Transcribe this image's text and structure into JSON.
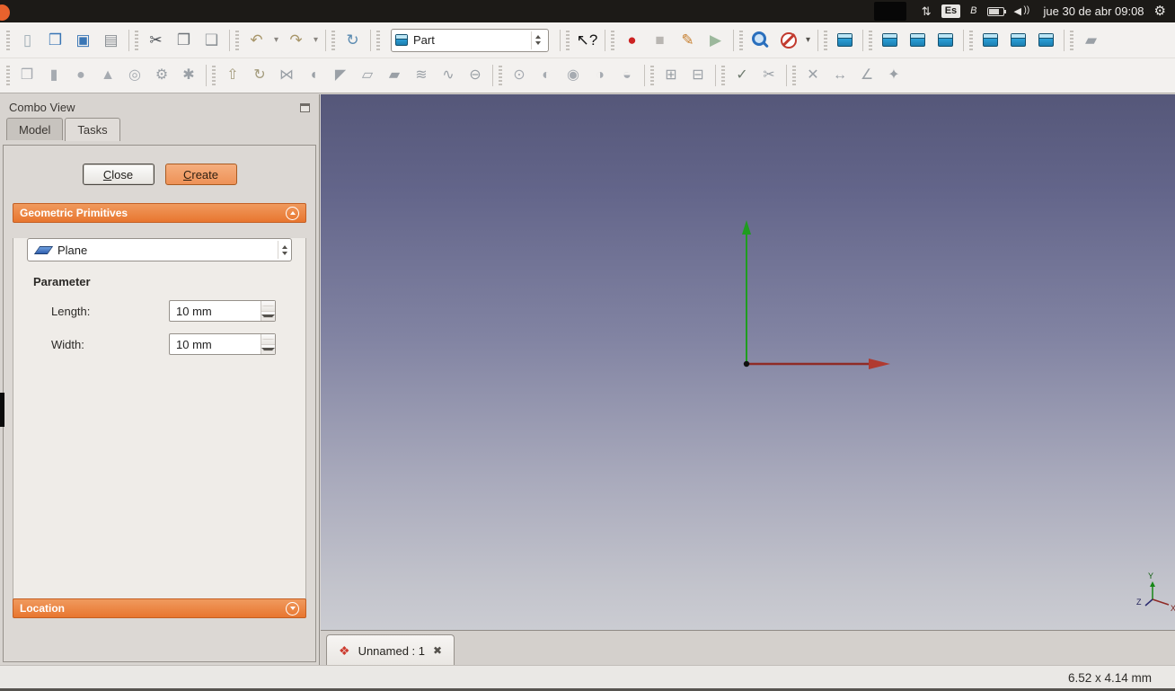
{
  "system_bar": {
    "keyboard_layout": "Es",
    "clock": "jue 30 de abr 09:08"
  },
  "main_toolbar": {
    "workbench_selector": {
      "value": "Part"
    },
    "groups": [
      [
        {
          "name": "new-file",
          "glyph": "▯",
          "color": "#9fadb6"
        },
        {
          "name": "open-file",
          "glyph": "❒",
          "color": "#3a76b5"
        },
        {
          "name": "save-file",
          "glyph": "▣",
          "color": "#3a76b5"
        },
        {
          "name": "print",
          "glyph": "▤",
          "color": "#8a8f94"
        }
      ],
      [
        {
          "name": "cut",
          "glyph": "✂",
          "color": "#4a4e53"
        },
        {
          "name": "copy",
          "glyph": "❐",
          "color": "#6e7378"
        },
        {
          "name": "paste",
          "glyph": "❑",
          "color": "#8a8f94"
        }
      ],
      [
        {
          "name": "undo",
          "glyph": "↶",
          "color": "#a8966a"
        },
        {
          "name": "undo-menu",
          "glyph": "▾",
          "color": "#8a8680",
          "small": true
        },
        {
          "name": "redo",
          "glyph": "↷",
          "color": "#a8966a"
        },
        {
          "name": "redo-menu",
          "glyph": "▾",
          "color": "#8a8680",
          "small": true
        }
      ],
      [
        {
          "name": "refresh",
          "glyph": "↻",
          "color": "#5a8ab0"
        }
      ],
      [
        {
          "special": "workbench"
        }
      ],
      [
        {
          "name": "whats-this",
          "glyph": "↖?",
          "color": "#141414"
        }
      ],
      [
        {
          "name": "macro-record",
          "glyph": "●",
          "color": "#cc2222"
        },
        {
          "name": "macro-stop",
          "glyph": "■",
          "color": "#b9b6b2"
        },
        {
          "name": "macro-edit",
          "glyph": "✎",
          "color": "#c77f2e"
        },
        {
          "name": "macro-play",
          "glyph": "▶",
          "color": "#9cb89c"
        }
      ],
      [
        {
          "name": "fit-all",
          "shape": "mag"
        },
        {
          "name": "draw-style",
          "shape": "slash"
        },
        {
          "name": "draw-style-menu",
          "glyph": "▾",
          "color": "#55524d",
          "small": true
        }
      ],
      [
        {
          "name": "view-axonometric",
          "shape": "cube"
        }
      ],
      [
        {
          "name": "view-front",
          "shape": "cube"
        },
        {
          "name": "view-top",
          "shape": "cube"
        },
        {
          "name": "view-right",
          "shape": "cube"
        }
      ],
      [
        {
          "name": "view-rear",
          "shape": "cube"
        },
        {
          "name": "view-bottom",
          "shape": "cube"
        },
        {
          "name": "view-left",
          "shape": "cube"
        }
      ],
      [
        {
          "name": "measure-distance",
          "glyph": "▰",
          "color": "#9aa0a6"
        }
      ]
    ]
  },
  "part_toolbar": {
    "groups": [
      [
        {
          "name": "part-box",
          "glyph": "❒",
          "color": "#a6abb1"
        },
        {
          "name": "part-cylinder",
          "glyph": "▮",
          "color": "#a6abb1"
        },
        {
          "name": "part-sphere",
          "glyph": "●",
          "color": "#a6abb1"
        },
        {
          "name": "part-cone",
          "glyph": "▲",
          "color": "#a6abb1"
        },
        {
          "name": "part-torus",
          "glyph": "◎",
          "color": "#a6abb1"
        },
        {
          "name": "part-create-primitives",
          "glyph": "⚙",
          "color": "#9aa0a6"
        },
        {
          "name": "part-shape-builder",
          "glyph": "✱",
          "color": "#9aa0a6"
        }
      ],
      [
        {
          "name": "part-extrude",
          "glyph": "⇧",
          "color": "#a39b7c"
        },
        {
          "name": "part-revolve",
          "glyph": "↻",
          "color": "#a39b7c"
        },
        {
          "name": "part-mirror",
          "glyph": "⋈",
          "color": "#9aa0a6"
        },
        {
          "name": "part-fillet",
          "glyph": "◖",
          "color": "#9aa0a6"
        },
        {
          "name": "part-chamfer",
          "glyph": "◤",
          "color": "#9aa0a6"
        },
        {
          "name": "part-make-face",
          "glyph": "▱",
          "color": "#9aa0a6"
        },
        {
          "name": "part-ruled-surface",
          "glyph": "▰",
          "color": "#9aa0a6"
        },
        {
          "name": "part-loft",
          "glyph": "≋",
          "color": "#9aa0a6"
        },
        {
          "name": "part-sweep",
          "glyph": "∿",
          "color": "#9aa0a6"
        },
        {
          "name": "part-offset",
          "glyph": "⊖",
          "color": "#9aa0a6"
        }
      ],
      [
        {
          "name": "part-boolean",
          "glyph": "⊙",
          "color": "#a6abb1"
        },
        {
          "name": "part-cut",
          "glyph": "◐",
          "color": "#a6abb1"
        },
        {
          "name": "part-union",
          "glyph": "◉",
          "color": "#a6abb1"
        },
        {
          "name": "part-common",
          "glyph": "◑",
          "color": "#a6abb1"
        },
        {
          "name": "part-section",
          "glyph": "◒",
          "color": "#a6abb1"
        }
      ],
      [
        {
          "name": "part-make-compound",
          "glyph": "⊞",
          "color": "#9aa0a6"
        },
        {
          "name": "part-explode-compound",
          "glyph": "⊟",
          "color": "#9aa0a6"
        }
      ],
      [
        {
          "name": "part-check-geometry",
          "glyph": "✓",
          "color": "#6f7b6f"
        },
        {
          "name": "part-defeaturing",
          "glyph": "✂",
          "color": "#9aa0a6"
        }
      ],
      [
        {
          "name": "part-cross-sections",
          "glyph": "✕",
          "color": "#9aa0a6"
        },
        {
          "name": "part-measure-linear",
          "glyph": "↔",
          "color": "#9aa0a6"
        },
        {
          "name": "part-measure-angular",
          "glyph": "∠",
          "color": "#9aa0a6"
        },
        {
          "name": "part-refine-shape",
          "glyph": "✦",
          "color": "#9aa0a6"
        }
      ]
    ]
  },
  "combo_view": {
    "title": "Combo View",
    "tabs": {
      "model": "Model",
      "tasks": "Tasks"
    },
    "active_tab": "Tasks",
    "buttons": {
      "close": "Close",
      "create": "Create"
    },
    "geometric_primitives": {
      "title": "Geometric Primitives",
      "primitive_dropdown": {
        "value": "Plane"
      },
      "parameter_heading": "Parameter",
      "fields": [
        {
          "label": "Length:",
          "value": "10 mm"
        },
        {
          "label": "Width:",
          "value": "10 mm"
        }
      ]
    },
    "location": {
      "title": "Location"
    }
  },
  "viewport": {
    "document_tab": {
      "icon": "❖",
      "label": "Unnamed : 1",
      "close_glyph": "✖"
    },
    "axis_labels": {
      "x": "X",
      "y": "Y",
      "z": "Z"
    }
  },
  "status_bar": {
    "size_readout": "6.52 x 4.14 mm"
  },
  "colors": {
    "accent_orange": "#e8762f",
    "viewport_top": "#555779",
    "viewport_bottom": "#cbccd2"
  }
}
